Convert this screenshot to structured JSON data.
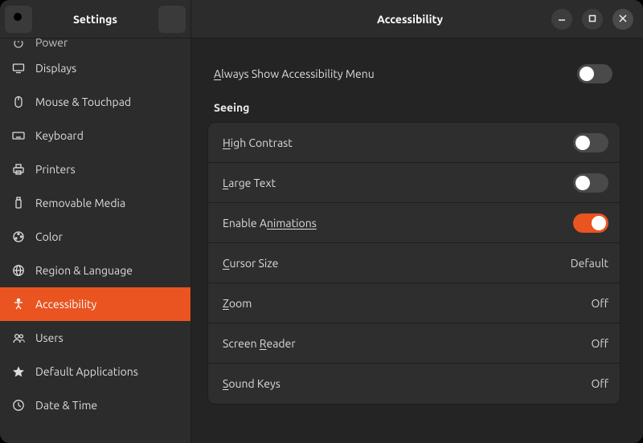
{
  "app_title": "Settings",
  "page_title": "Accessibility",
  "sidebar": {
    "items": [
      {
        "label": "Power",
        "icon": "power-icon",
        "active": false,
        "partial": true
      },
      {
        "label": "Displays",
        "icon": "displays-icon",
        "active": false
      },
      {
        "label": "Mouse & Touchpad",
        "icon": "mouse-icon",
        "active": false
      },
      {
        "label": "Keyboard",
        "icon": "keyboard-icon",
        "active": false
      },
      {
        "label": "Printers",
        "icon": "printers-icon",
        "active": false
      },
      {
        "label": "Removable Media",
        "icon": "usb-icon",
        "active": false
      },
      {
        "label": "Color",
        "icon": "color-icon",
        "active": false
      },
      {
        "label": "Region & Language",
        "icon": "globe-icon",
        "active": false
      },
      {
        "label": "Accessibility",
        "icon": "accessibility-icon",
        "active": true
      },
      {
        "label": "Users",
        "icon": "users-icon",
        "active": false
      },
      {
        "label": "Default Applications",
        "icon": "star-icon",
        "active": false
      },
      {
        "label": "Date & Time",
        "icon": "clock-icon",
        "active": false
      }
    ]
  },
  "always_show_label_pre": "A",
  "always_show_label_post": "lways Show Accessibility Menu",
  "always_show_on": false,
  "section_seeing": "Seeing",
  "rows": {
    "high_contrast_pre": "H",
    "high_contrast_post": "igh Contrast",
    "high_contrast_on": false,
    "large_text_pre": "L",
    "large_text_post": "arge Text",
    "large_text_on": false,
    "enable_anim_pre": "Enable A",
    "enable_anim_post": "nimations",
    "enable_anim_on": true,
    "cursor_label_pre": "C",
    "cursor_label_post": "ursor Size",
    "cursor_value": "Default",
    "zoom_label_pre": "Z",
    "zoom_label_post": "oom",
    "zoom_value": "Off",
    "reader_label_pre": "Screen ",
    "reader_label_mid": "R",
    "reader_label_post": "eader",
    "reader_value": "Off",
    "sound_label_pre": "S",
    "sound_label_post": "ound Keys",
    "sound_value": "Off"
  },
  "colors": {
    "accent": "#e95420"
  }
}
